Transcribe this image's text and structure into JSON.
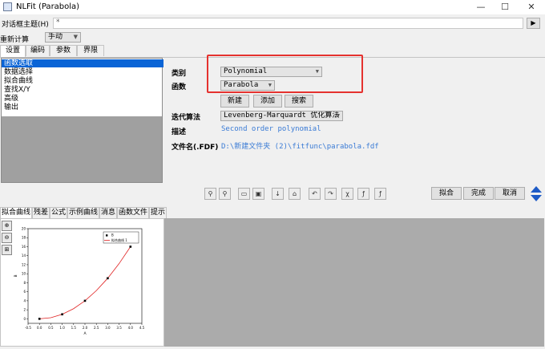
{
  "window": {
    "title": "NLFit (Parabola)",
    "controls": {
      "minimize": "—",
      "maximize": "☐",
      "close": "✕"
    }
  },
  "theme": {
    "label": "对话框主题(H)",
    "value": "*",
    "arrow": "▶"
  },
  "recalc": {
    "label": "重新计算",
    "value": "手动"
  },
  "top_tabs": [
    "设置",
    "编码",
    "参数",
    "界限"
  ],
  "nav_items": [
    "函数选取",
    "数据选择",
    "拟合曲线",
    "查找X/Y",
    "高级",
    "输出"
  ],
  "form": {
    "category_label": "类别",
    "category_value": "Polynomial",
    "function_label": "函数",
    "function_value": "Parabola",
    "btn_new": "新建",
    "btn_add": "添加",
    "btn_search": "搜索",
    "iter_label": "迭代算法",
    "iter_value": "Levenberg-Marquardt 优化算法",
    "desc_label": "描述",
    "desc_value": "Second order polynomial",
    "file_label": "文件名(.FDF)",
    "file_value": "D:\\新建文件夹 (2)\\fitfunc\\parabola.fdf"
  },
  "toolbar_icons": [
    "fit-once-icon",
    "fit-iter-icon",
    "open-icon",
    "save-icon",
    "params-icon",
    "home-icon",
    "undo-icon",
    "redo-icon",
    "chisq-icon",
    "fit-icon",
    "fit-until-icon"
  ],
  "actions": {
    "fit": "拟合",
    "done": "完成",
    "cancel": "取消"
  },
  "bottom_tabs": [
    "拟合曲线",
    "残差",
    "公式",
    "示例曲线",
    "消息",
    "函数文件",
    "提示"
  ],
  "chart_data": {
    "type": "scatter",
    "series": [
      {
        "name": "B",
        "kind": "scatter",
        "x": [
          0,
          1,
          2,
          3,
          4
        ],
        "y": [
          0,
          1,
          4,
          9,
          16
        ]
      },
      {
        "name": "拟合曲线 1",
        "kind": "line",
        "x": [
          0,
          0.5,
          1,
          1.5,
          2,
          2.5,
          3,
          3.5,
          4
        ],
        "y": [
          0,
          0.25,
          1,
          2.25,
          4,
          6.25,
          9,
          12.25,
          16
        ]
      }
    ],
    "xlabel": "A",
    "ylabel": "B",
    "xlim": [
      -0.5,
      4.5
    ],
    "ylim": [
      -1,
      20
    ],
    "xticks": [
      "-0.5",
      "0.0",
      "0.5",
      "1.0",
      "1.5",
      "2.0",
      "2.5",
      "3.0",
      "3.5",
      "4.0",
      "4.5"
    ],
    "yticks": [
      "0",
      "2",
      "4",
      "6",
      "8",
      "10",
      "12",
      "14",
      "16",
      "18",
      "20"
    ],
    "grid": false,
    "legend": "top-right",
    "colors": {
      "points": "#000000",
      "fit_line": "#e02020"
    }
  },
  "highlight_color": "#e5322f"
}
